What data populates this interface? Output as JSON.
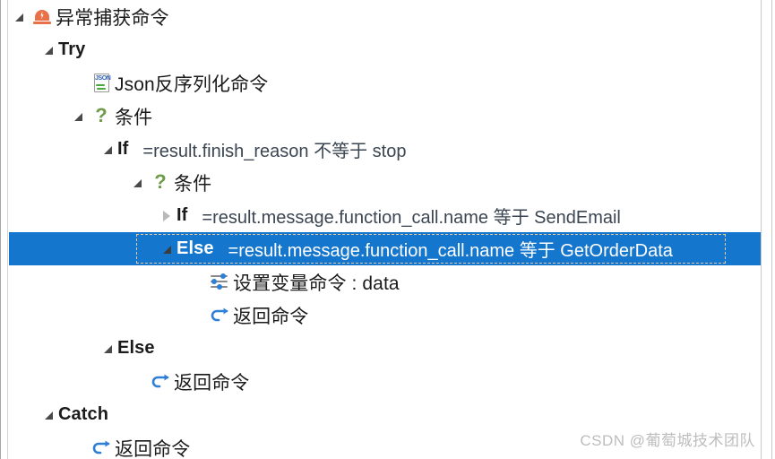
{
  "window": {
    "title": "异常捕获命令"
  },
  "tree": {
    "rows": [
      {
        "indent": 0,
        "expander": "down",
        "icon": "alarm-icon",
        "label": "异常捕获命令",
        "expr": "",
        "selected": false
      },
      {
        "indent": 1,
        "expander": "down",
        "icon": "none",
        "label": "Try",
        "expr": "",
        "selected": false
      },
      {
        "indent": 2,
        "expander": "none",
        "icon": "json-icon",
        "label": "Json反序列化命令",
        "expr": "",
        "selected": false
      },
      {
        "indent": 2,
        "expander": "down",
        "icon": "question-icon",
        "label": "条件",
        "expr": "",
        "selected": false
      },
      {
        "indent": 3,
        "expander": "down",
        "icon": "none",
        "label": "If",
        "expr": "=result.finish_reason 不等于 stop",
        "selected": false
      },
      {
        "indent": 4,
        "expander": "down",
        "icon": "question-icon",
        "label": "条件",
        "expr": "",
        "selected": false
      },
      {
        "indent": 5,
        "expander": "right",
        "icon": "none",
        "label": "If",
        "expr": "=result.message.function_call.name 等于 SendEmail",
        "selected": false
      },
      {
        "indent": 5,
        "expander": "down",
        "icon": "none",
        "label": "Else",
        "expr": "=result.message.function_call.name 等于 GetOrderData",
        "selected": true
      },
      {
        "indent": 6,
        "expander": "none",
        "icon": "set-variable-icon",
        "label": "设置变量命令 : data",
        "expr": "",
        "selected": false
      },
      {
        "indent": 6,
        "expander": "none",
        "icon": "return-icon",
        "label": "返回命令",
        "expr": "",
        "selected": false
      },
      {
        "indent": 3,
        "expander": "down",
        "icon": "none",
        "label": "Else",
        "expr": "",
        "selected": false
      },
      {
        "indent": 4,
        "expander": "none",
        "icon": "return-icon",
        "label": "返回命令",
        "expr": "",
        "selected": false
      },
      {
        "indent": 1,
        "expander": "down",
        "icon": "none",
        "label": "Catch",
        "expr": "",
        "selected": false
      },
      {
        "indent": 2,
        "expander": "none",
        "icon": "return-icon",
        "label": "返回命令",
        "expr": "",
        "selected": false
      }
    ]
  },
  "watermark": {
    "text": "CSDN @葡萄城技术团队"
  },
  "colors": {
    "selection": "#1476cd",
    "alarm": "#e8714a",
    "question": "#6f9b4a",
    "return_arrow": "#2f7fd4",
    "expression_text": "#3b4652",
    "watermark": "#bdbdbd"
  }
}
